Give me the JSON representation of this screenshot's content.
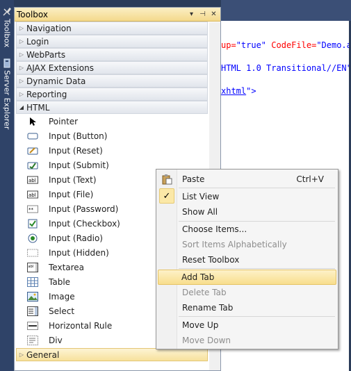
{
  "side_tabs": [
    {
      "label": "Toolbox",
      "icon": "wrench-icon"
    },
    {
      "label": "Server Explorer",
      "icon": "server-icon"
    }
  ],
  "toolbox": {
    "title": "Toolbox",
    "buttons": {
      "dropdown": "▾",
      "pin": "⊣",
      "close": "✕"
    },
    "categories_collapsed": [
      "Navigation",
      "Login",
      "WebParts",
      "AJAX Extensions",
      "Dynamic Data",
      "Reporting"
    ],
    "expanded_category": "HTML",
    "items": [
      {
        "label": "Pointer",
        "icon": "pointer-icon"
      },
      {
        "label": "Input (Button)",
        "icon": "input-button-icon"
      },
      {
        "label": "Input (Reset)",
        "icon": "input-reset-icon"
      },
      {
        "label": "Input (Submit)",
        "icon": "input-submit-icon"
      },
      {
        "label": "Input (Text)",
        "icon": "input-text-icon"
      },
      {
        "label": "Input (File)",
        "icon": "input-file-icon"
      },
      {
        "label": "Input (Password)",
        "icon": "input-password-icon"
      },
      {
        "label": "Input (Checkbox)",
        "icon": "checkbox-icon"
      },
      {
        "label": "Input (Radio)",
        "icon": "radio-icon"
      },
      {
        "label": "Input (Hidden)",
        "icon": "hidden-input-icon"
      },
      {
        "label": "Textarea",
        "icon": "textarea-icon"
      },
      {
        "label": "Table",
        "icon": "table-icon"
      },
      {
        "label": "Image",
        "icon": "image-icon"
      },
      {
        "label": "Select",
        "icon": "select-icon"
      },
      {
        "label": "Horizontal Rule",
        "icon": "horizontal-rule-icon"
      },
      {
        "label": "Div",
        "icon": "div-icon"
      }
    ],
    "general_category": "General"
  },
  "editor": {
    "line1": {
      "a1": "up=",
      "v1": "\"true\"",
      "sp": " ",
      "a2": "CodeFile=",
      "v2": "\"Demo.as"
    },
    "line2": "HTML 1.0 Transitional//EN\"",
    "line3": {
      "u": "xhtml",
      "rest": "\">"
    }
  },
  "context_menu": {
    "paste": {
      "label": "Paste",
      "shortcut": "Ctrl+V"
    },
    "list_view": "List View",
    "show_all": "Show All",
    "choose_items": "Choose Items...",
    "sort_items": "Sort Items Alphabetically",
    "reset_toolbox": "Reset Toolbox",
    "add_tab": "Add Tab",
    "delete_tab": "Delete Tab",
    "rename_tab": "Rename Tab",
    "move_up": "Move Up",
    "move_down": "Move Down"
  },
  "colors": {
    "accent_highlight": "#f8de8d",
    "title_bar": "#f4d98c",
    "ide_background": "#2b3c59"
  }
}
